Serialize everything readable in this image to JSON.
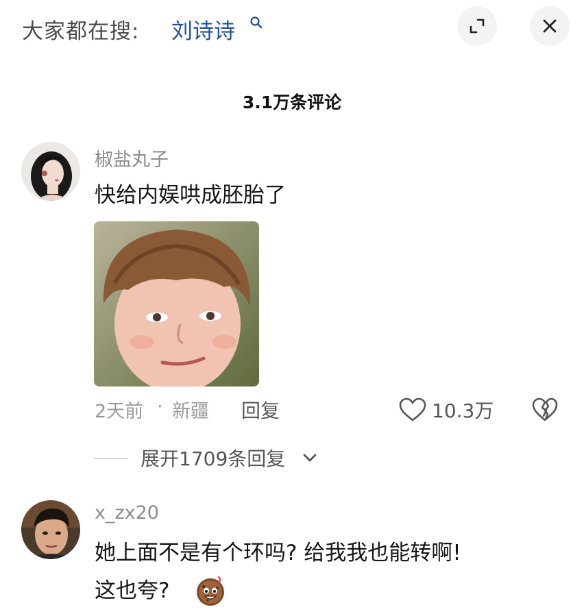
{
  "search_bar": {
    "prefix": "大家都在搜:",
    "term": "刘诗诗",
    "search_icon": "search-icon",
    "expand_icon": "expand-icon",
    "close_icon": "close-icon"
  },
  "comments_header": {
    "title": "3.1万条评论"
  },
  "comments": [
    {
      "username": "椒盐丸子",
      "text": "快给内娱哄成胚胎了",
      "has_image": true,
      "time": "2天前",
      "separator": "·",
      "location": "新疆",
      "reply_label": "回复",
      "like_count": "10.3万",
      "expand_replies_label": "展开1709条回复"
    },
    {
      "username": "x_zx20",
      "text_line1": "她上面不是有个环吗? 给我我也能转啊!",
      "text_line2": "这也夸?",
      "emoji": "cookie-face-emoji"
    }
  ],
  "colors": {
    "search_term": "#1e4f9c",
    "button_bg": "#f3f3f3",
    "muted_text": "#9a9a9a"
  }
}
